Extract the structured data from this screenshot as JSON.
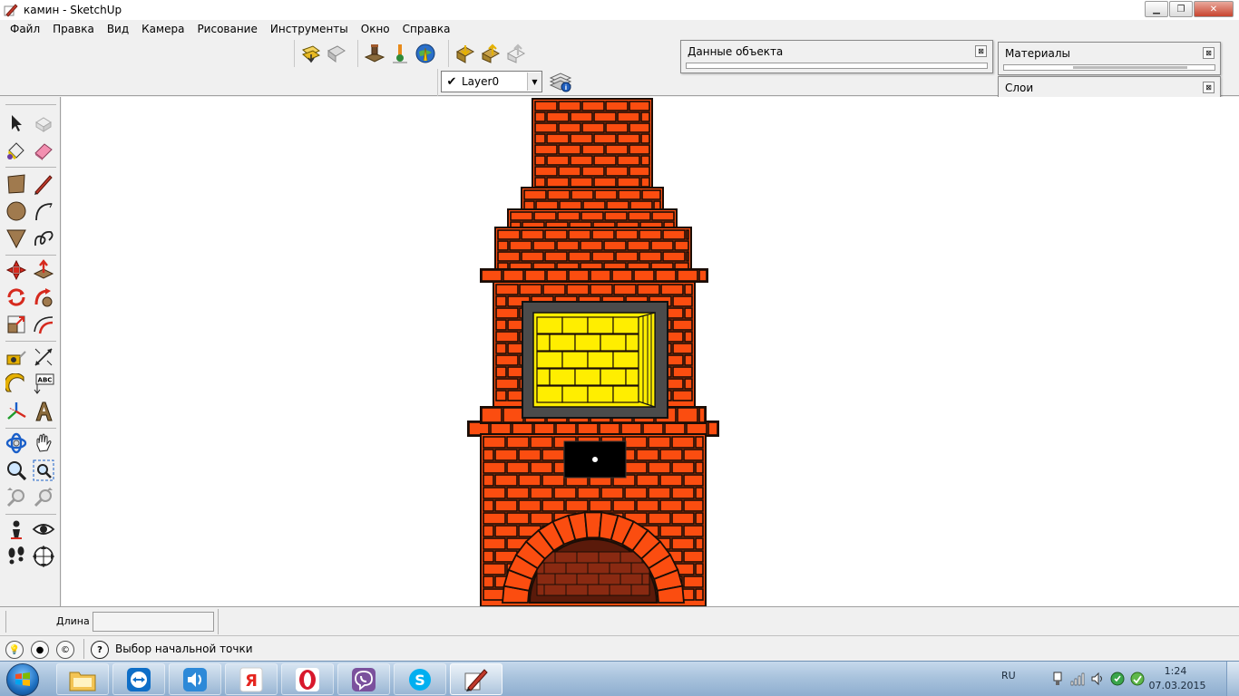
{
  "window": {
    "title": "камин - SketchUp"
  },
  "menu": {
    "items": [
      "Файл",
      "Правка",
      "Вид",
      "Камера",
      "Рисование",
      "Инструменты",
      "Окно",
      "Справка"
    ]
  },
  "layers": {
    "current": "Layer0",
    "checked": true
  },
  "panels": {
    "entity_info": {
      "title": "Данные объекта"
    },
    "materials": {
      "title": "Материалы"
    },
    "layers": {
      "title": "Слои"
    }
  },
  "measurements": {
    "label": "Длина",
    "value": ""
  },
  "status": {
    "text": "Выбор начальной точки"
  },
  "tools": [
    "select-icon",
    "make-component-icon",
    "paint-bucket-icon",
    "eraser-icon",
    "rectangle-icon",
    "pencil-icon",
    "circle-icon",
    "arc-icon",
    "polygon-icon",
    "freehand-icon",
    "move-icon",
    "push-pull-icon",
    "rotate-icon",
    "follow-me-icon",
    "scale-icon",
    "offset-icon",
    "tape-measure-icon",
    "dimension-icon",
    "protractor-icon",
    "text-icon",
    "axes-icon",
    "3d-text-icon",
    "orbit-icon",
    "pan-icon",
    "zoom-icon",
    "zoom-window-icon",
    "previous-view-icon",
    "next-view-icon",
    "walk-icon",
    "look-around-icon",
    "footprints-icon",
    "section-plane-icon"
  ],
  "taskbar": {
    "apps": [
      "explorer",
      "teamviewer",
      "media-player",
      "yandex-browser",
      "opera",
      "viber",
      "skype",
      "sketchup"
    ],
    "language": "RU",
    "time": "1:24",
    "date": "07.03.2015"
  },
  "colors": {
    "brick": "#fb4d10",
    "brick_line": "#1a0d06",
    "firebox_tile": "#ffee00",
    "frame": "#4b4b4b",
    "canvas": "#ffffff"
  }
}
